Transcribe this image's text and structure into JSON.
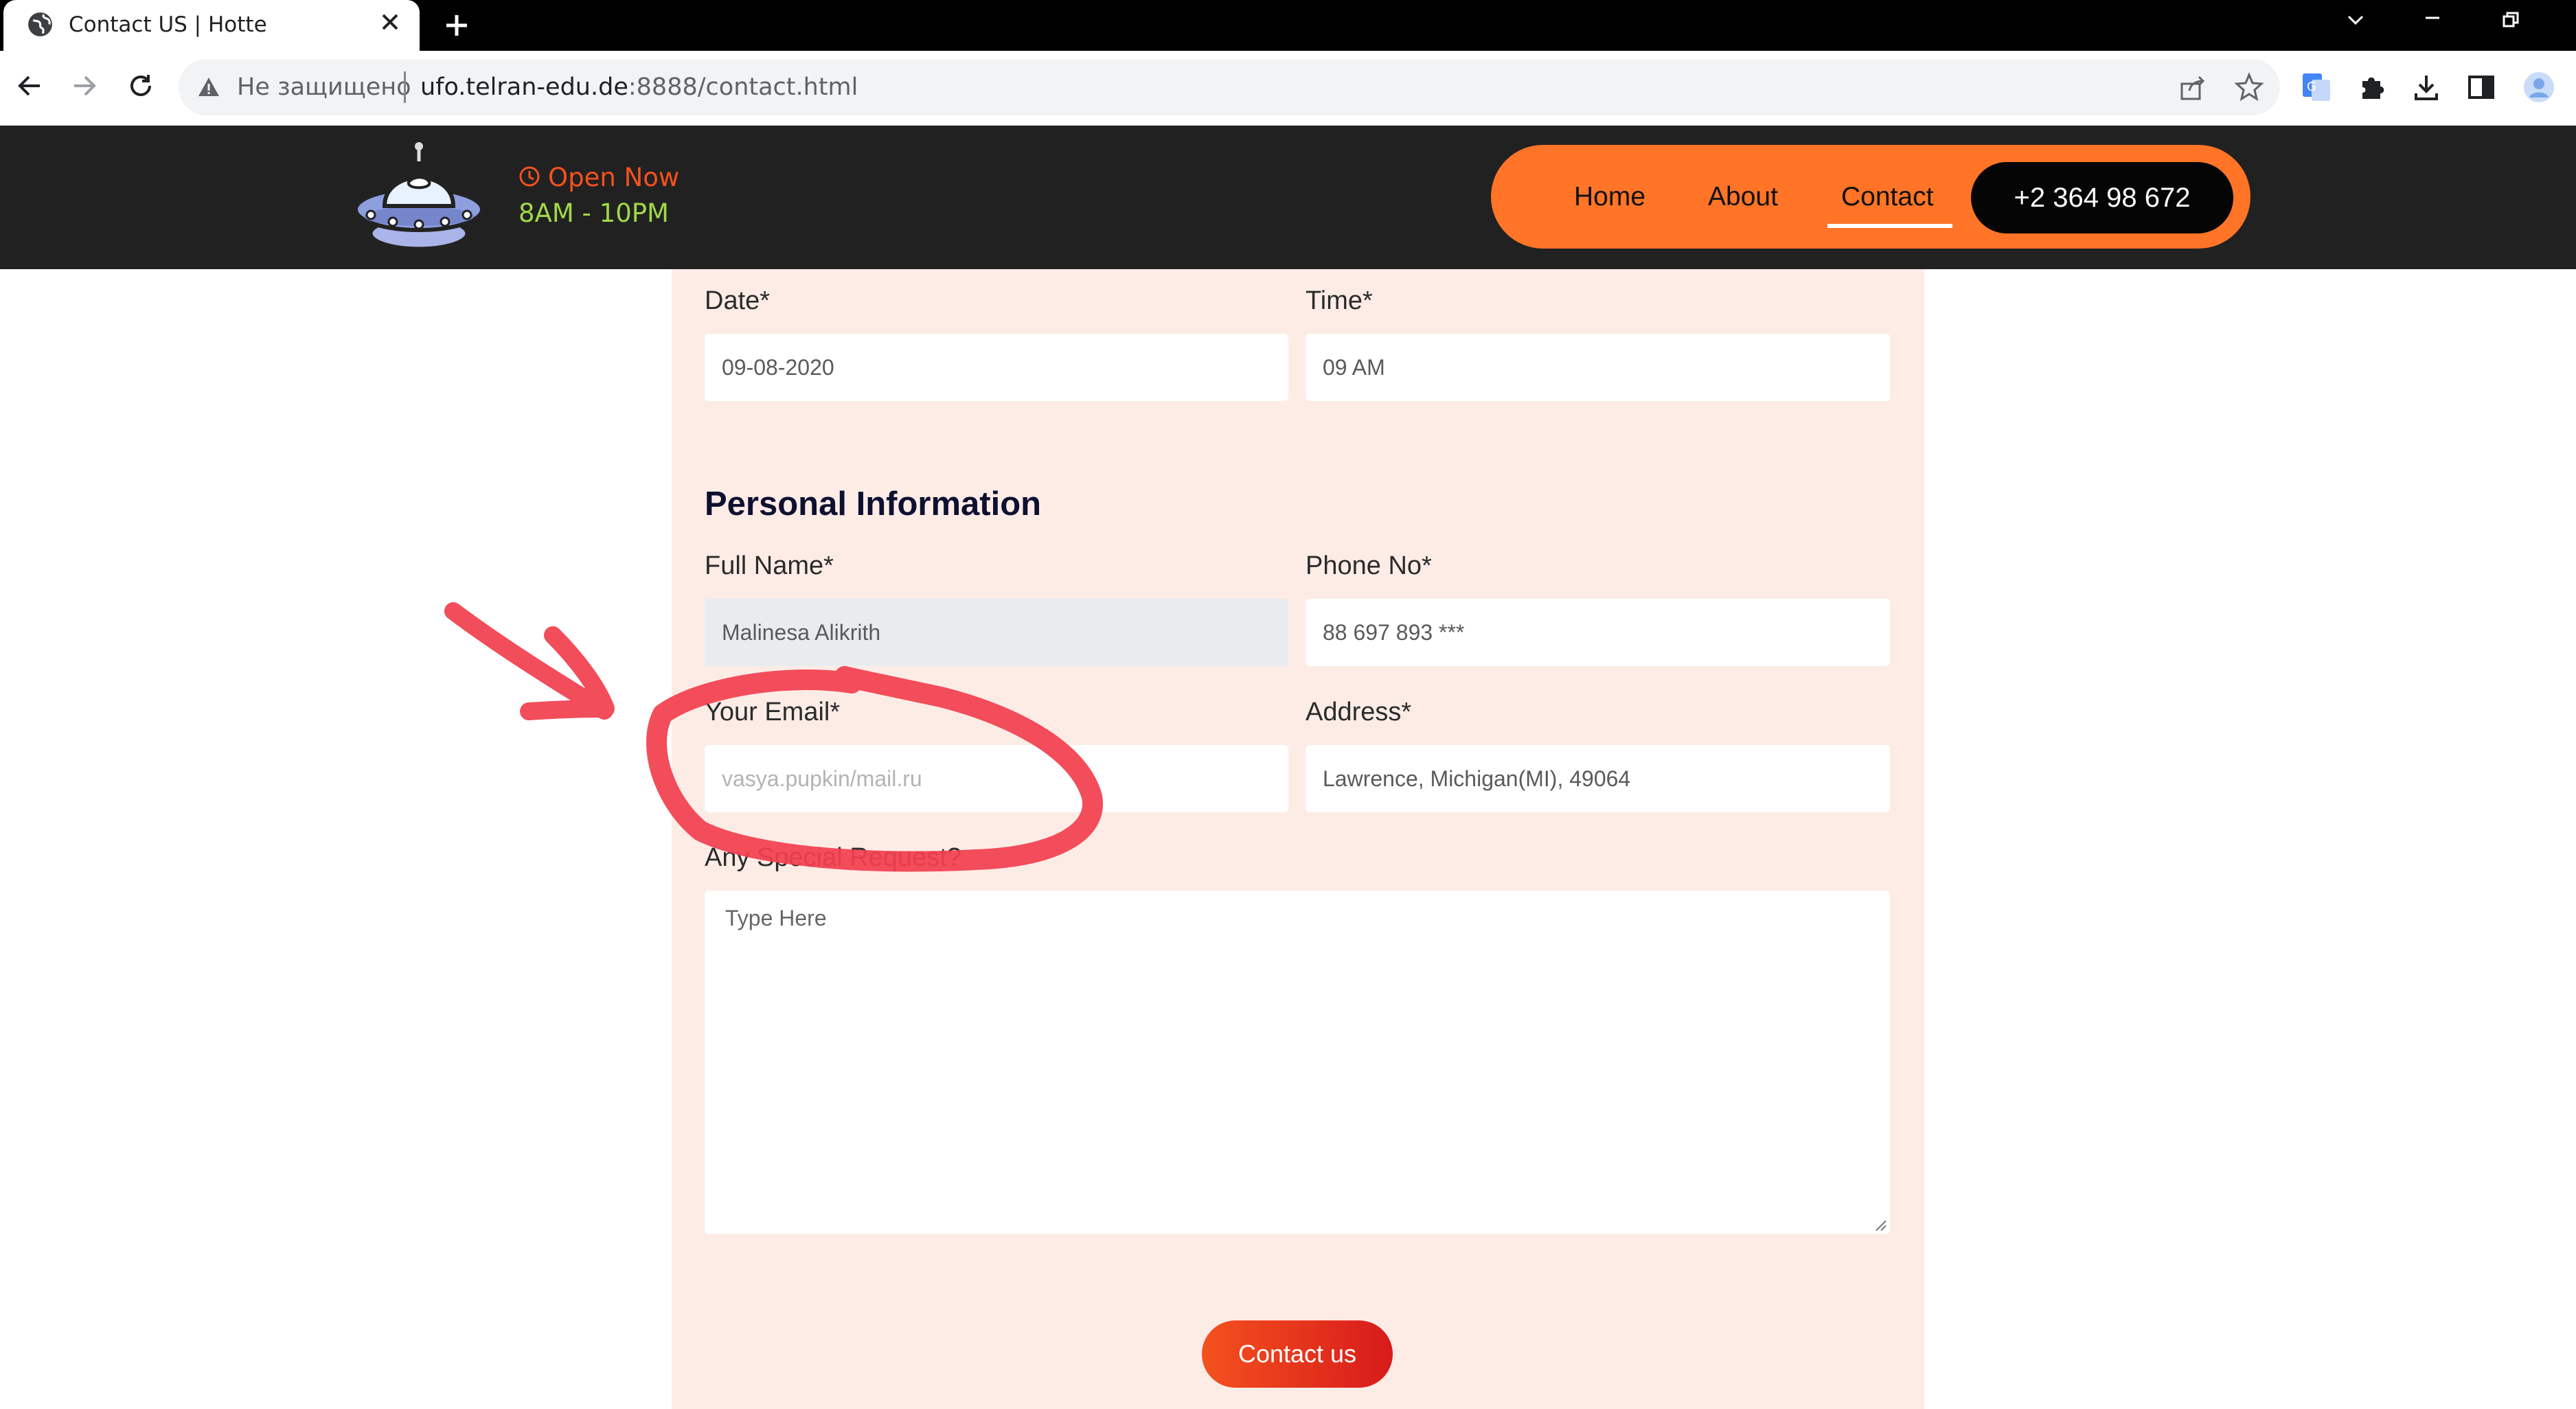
{
  "browser": {
    "tab_title": "Contact US | Hotte",
    "security_text": "Не защищено",
    "url_host": "ufo.telran-edu.de",
    "url_rest": ":8888/contact.html"
  },
  "site_header": {
    "open_status": "Open Now",
    "hours": "8AM - 10PM",
    "nav": {
      "home": "Home",
      "about": "About",
      "contact": "Contact"
    },
    "phone": "+2 364 98 672",
    "active_nav": "Contact",
    "colors": {
      "header_bg": "#212121",
      "nav_pill": "#ff7426",
      "open_now": "#f4511e",
      "hours": "#a0d84a"
    }
  },
  "form": {
    "date_label": "Date*",
    "date_value": "09-08-2020",
    "time_label": "Time*",
    "time_value": "09 AM",
    "personal_heading": "Personal Information",
    "full_name_label": "Full Name*",
    "full_name_value": "Malinesa Alikrith",
    "phone_label": "Phone No*",
    "phone_value": "88 697 893 ***",
    "email_label": "Your Email*",
    "email_placeholder": "vasya.pupkin/mail.ru",
    "address_label": "Address*",
    "address_value": "Lawrence, Michigan(MI), 49064",
    "request_label": "Any Special Request?",
    "request_placeholder": "Type Here",
    "submit_label": "Contact us",
    "colors": {
      "panel_bg": "#fdece6",
      "submit_start": "#f4511e",
      "submit_end": "#d81b1b"
    }
  },
  "annotation": {
    "color": "#f2404f",
    "shapes": [
      "arrow",
      "circle-around-email-field"
    ]
  }
}
